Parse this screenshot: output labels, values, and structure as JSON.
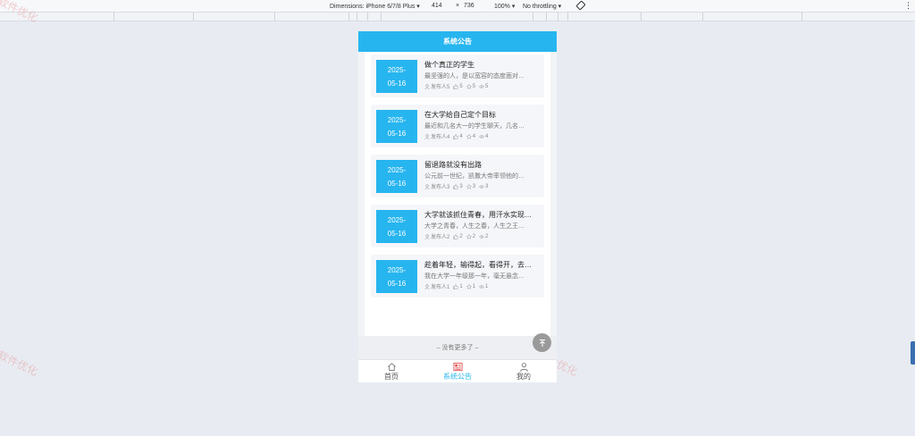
{
  "devtools": {
    "dimensions_label": "Dimensions: iPhone 6/7/8 Plus ▾",
    "width": "414",
    "times": "×",
    "height": "736",
    "zoom": "100% ▾",
    "throttling": "No throttling ▾",
    "menu": "⋮"
  },
  "watermark_text": "软件优化",
  "header": {
    "title": "系统公告"
  },
  "notices": [
    {
      "date_line1": "2025-",
      "date_line2": "05-16",
      "title": "做个真正的学生",
      "excerpt": "最坚强的人，是以宽容的态度面对…",
      "author": "发布人5",
      "likes": "5",
      "favorites": "5",
      "views": "5"
    },
    {
      "date_line1": "2025-",
      "date_line2": "05-16",
      "title": "在大学给自己定个目标",
      "excerpt": "最近和几名大一的学生聊天，几名…",
      "author": "发布人4",
      "likes": "4",
      "favorites": "4",
      "views": "4"
    },
    {
      "date_line1": "2025-",
      "date_line2": "05-16",
      "title": "留退路就没有出路",
      "excerpt": "公元前一世纪，凯撒大帝率领他的…",
      "author": "发布人3",
      "likes": "3",
      "favorites": "3",
      "views": "3"
    },
    {
      "date_line1": "2025-",
      "date_line2": "05-16",
      "title": "大学就该抓住青春，用汗水实现…",
      "excerpt": "大学之青春，人生之春，人生之王…",
      "author": "发布人2",
      "likes": "2",
      "favorites": "2",
      "views": "2"
    },
    {
      "date_line1": "2025-",
      "date_line2": "05-16",
      "title": "趁着年轻，输得起，看得开，去…",
      "excerpt": "我在大学一年级那一年，毫无悬念…",
      "author": "发布人1",
      "likes": "1",
      "favorites": "1",
      "views": "1"
    }
  ],
  "no_more_text": "– 没有更多了 –",
  "back_to_top_icon": "arrow-up-to-top",
  "tabbar": [
    {
      "label": "首页",
      "icon": "home-icon",
      "active": false
    },
    {
      "label": "系统公告",
      "icon": "news-icon",
      "active": true
    },
    {
      "label": "我的",
      "icon": "user-icon",
      "active": false
    }
  ],
  "colors": {
    "accent": "#27b5ef",
    "background": "#e8ecf2"
  }
}
